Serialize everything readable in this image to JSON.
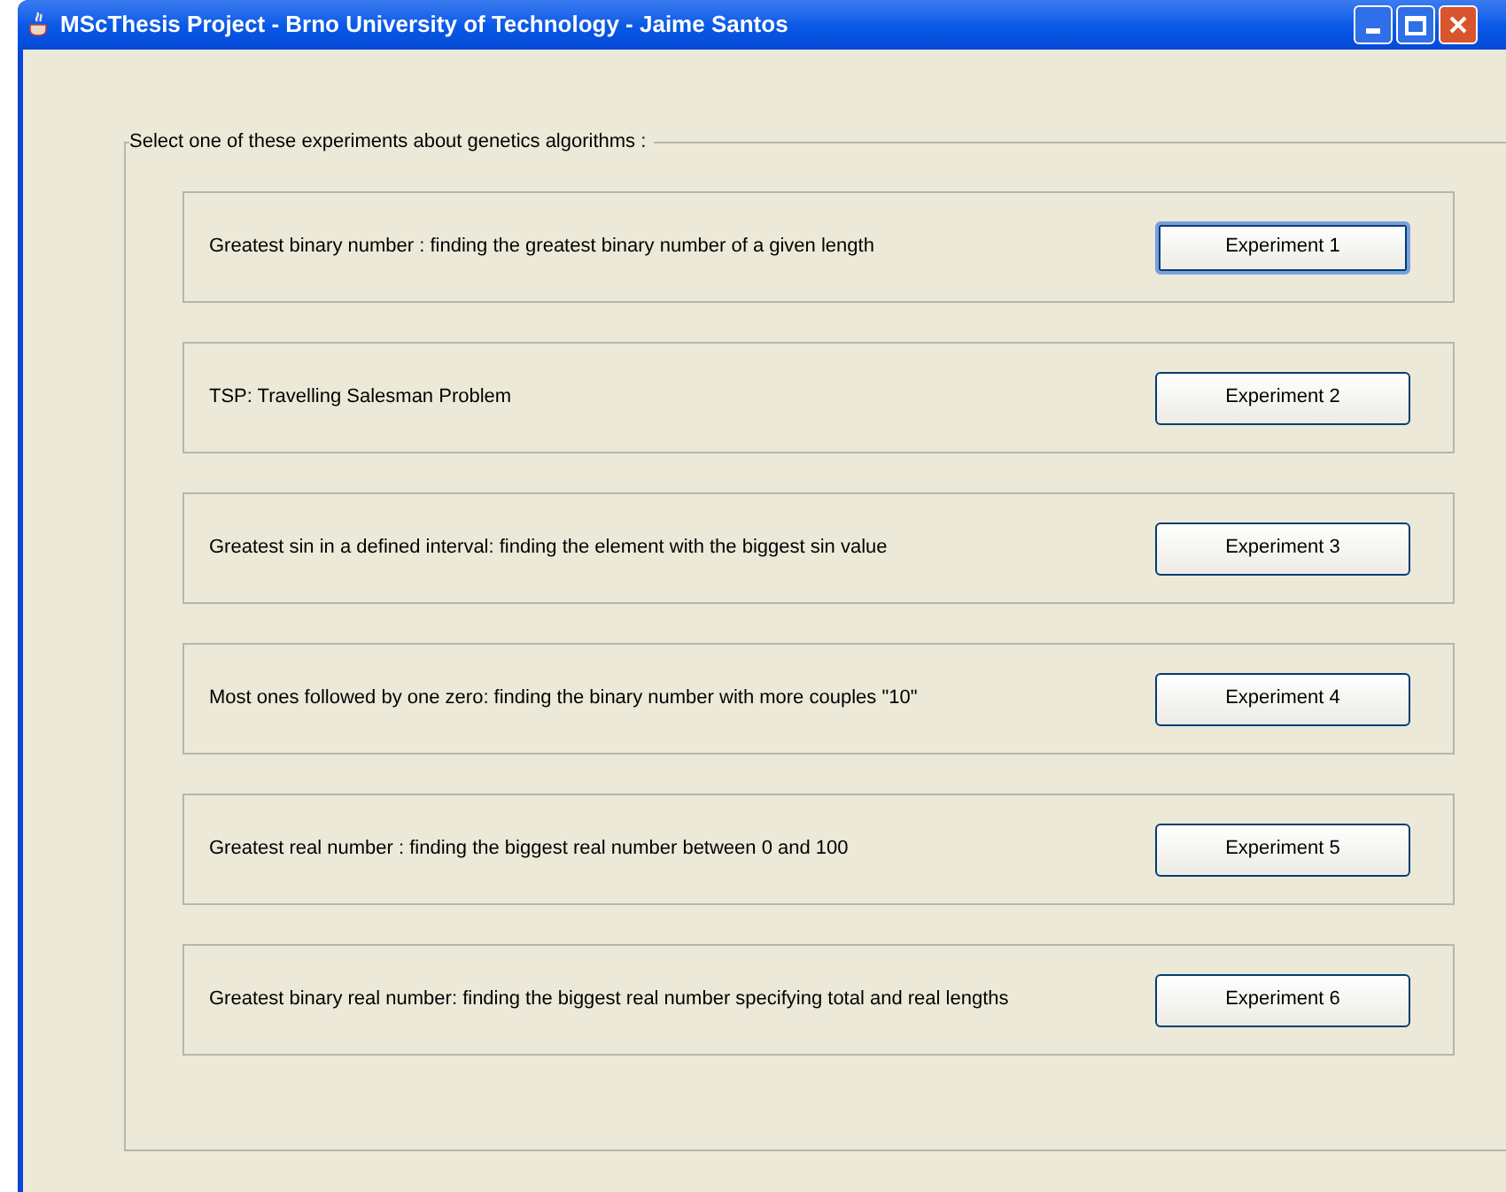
{
  "window": {
    "title": "MScThesis Project - Brno University of Technology - Jaime Santos"
  },
  "group": {
    "title": "Select one of these experiments about genetics algorithms :"
  },
  "experiments": [
    {
      "description": "Greatest binary number :  finding the greatest binary number of a given length",
      "button": "Experiment 1",
      "focused": true
    },
    {
      "description": "TSP: Travelling Salesman Problem",
      "button": "Experiment 2",
      "focused": false
    },
    {
      "description": "Greatest sin in a defined interval: finding the element with the biggest sin value",
      "button": "Experiment 3",
      "focused": false
    },
    {
      "description": "Most ones followed by one zero: finding the binary number with more couples \"10\"",
      "button": "Experiment 4",
      "focused": false
    },
    {
      "description": "Greatest real number :  finding the biggest real number between 0 and 100",
      "button": "Experiment 5",
      "focused": false
    },
    {
      "description": "Greatest binary real number: finding the biggest real number specifying total and real lengths",
      "button": "Experiment 6",
      "focused": false
    }
  ]
}
